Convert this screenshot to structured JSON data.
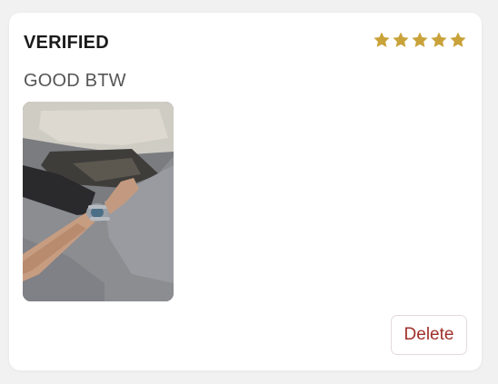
{
  "review": {
    "status": "VERIFIED",
    "rating": 5,
    "rating_max": 5,
    "text": "GOOD BTW",
    "photo_icon": "review-photo"
  },
  "actions": {
    "delete_label": "Delete"
  },
  "colors": {
    "star": "#c9a23a",
    "delete_text": "#a0302a",
    "card_bg": "#ffffff",
    "page_bg": "#f1f1f1"
  }
}
